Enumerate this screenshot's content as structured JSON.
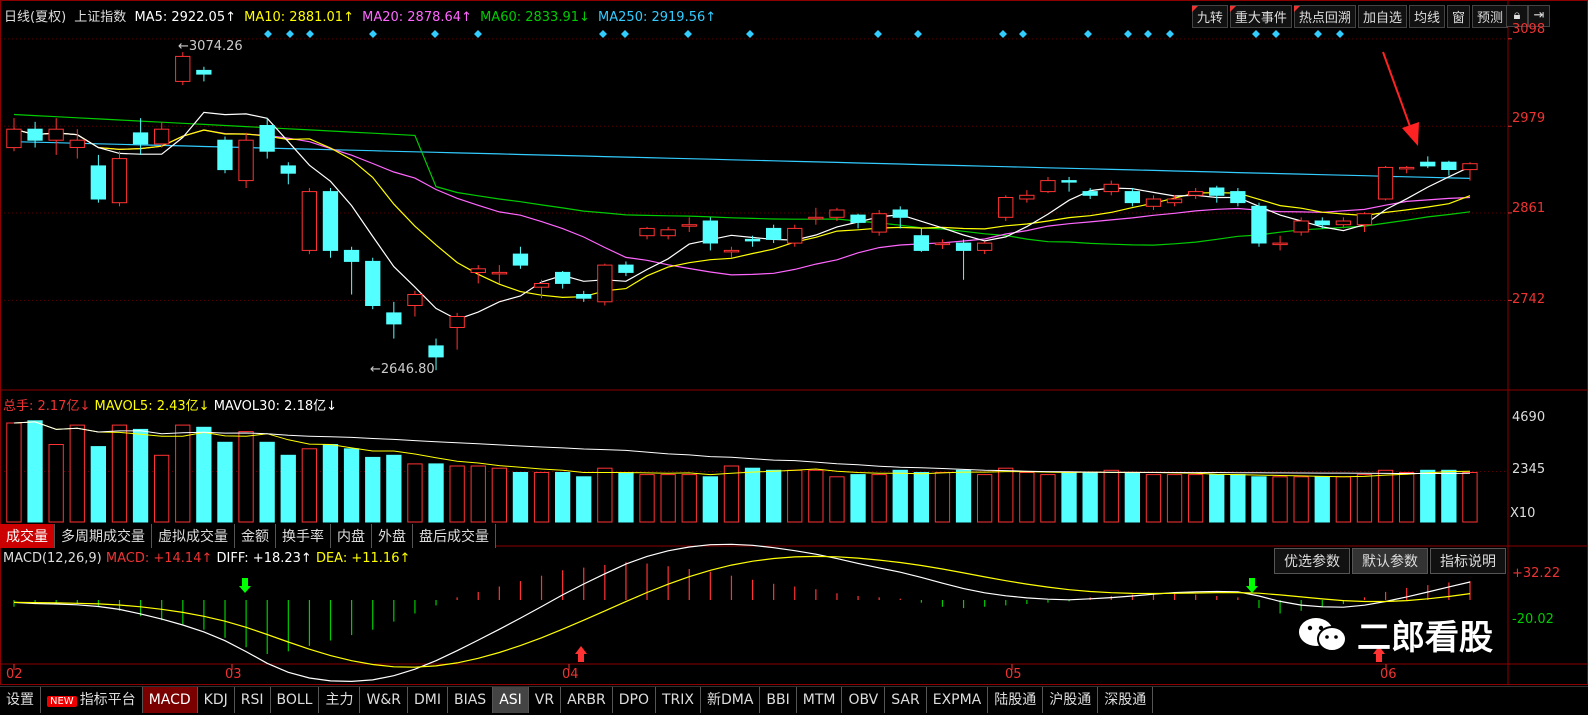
{
  "header": {
    "period": "日线(夏权)",
    "index_name": "上证指数",
    "ma5": "MA5: 2922.05↑",
    "ma10": "MA10: 2881.01↑",
    "ma20": "MA20: 2878.64↑",
    "ma60": "MA60: 2833.91↓",
    "ma250": "MA250: 2919.56↑"
  },
  "toolbar": [
    "九转",
    "重大事件",
    "热点回溯",
    "加自选",
    "均线",
    "窗",
    "预测"
  ],
  "toolbar_icons": [
    "lock-icon",
    "exit-icon"
  ],
  "price_axis": [
    "3098",
    "2979",
    "2861",
    "2742"
  ],
  "price_annotations": {
    "high": "3074.26",
    "low": "2646.80"
  },
  "volume_header": {
    "total": "总手: 2.17亿↓",
    "mavol5": "MAVOL5: 2.43亿↓",
    "mavol30": "MAVOL30: 2.18亿↓"
  },
  "volume_axis": [
    "4690",
    "2345",
    "X10"
  ],
  "volume_tabs": [
    "成交量",
    "多周期成交量",
    "虚拟成交量",
    "金额",
    "换手率",
    "内盘",
    "外盘",
    "盘后成交量"
  ],
  "macd_header": {
    "name": "MACD(12,26,9)",
    "macd": "MACD: +14.14↑",
    "diff": "DIFF: +18.23↑",
    "dea": "DEA: +11.16↑"
  },
  "macd_buttons": [
    "优选参数",
    "默认参数",
    "指标说明"
  ],
  "macd_axis": [
    "+32.22",
    "-20.02"
  ],
  "date_axis": [
    "02",
    "03",
    "04",
    "05",
    "06"
  ],
  "bottom_bar": [
    "设置",
    "指标平台",
    "MACD",
    "KDJ",
    "RSI",
    "BOLL",
    "主力",
    "W&R",
    "DMI",
    "BIAS",
    "ASI",
    "VR",
    "ARBR",
    "DPO",
    "TRIX",
    "新DMA",
    "BBI",
    "MTM",
    "OBV",
    "SAR",
    "EXPMA",
    "陆股通",
    "沪股通",
    "深股通"
  ],
  "new_badge": "NEW",
  "watermark": "二郎看股",
  "colors": {
    "up": "#ff3333",
    "down": "#54ffff",
    "ma5": "#ffffff",
    "ma10": "#ffff00",
    "ma20": "#ff66ff",
    "ma60": "#00cc00",
    "ma250": "#33ccff",
    "grid": "#8b0000"
  },
  "chart_data": {
    "type": "candlestick",
    "ylim": [
      2620,
      3110
    ],
    "candles": [
      [
        2950,
        2975,
        2945,
        2990,
        "u"
      ],
      [
        2975,
        2960,
        2950,
        2985,
        "d"
      ],
      [
        2960,
        2975,
        2940,
        2990,
        "u"
      ],
      [
        2950,
        2960,
        2935,
        2975,
        "u"
      ],
      [
        2925,
        2880,
        2875,
        2940,
        "d"
      ],
      [
        2875,
        2935,
        2870,
        2945,
        "u"
      ],
      [
        2970,
        2955,
        2940,
        2990,
        "d"
      ],
      [
        2955,
        2975,
        2950,
        2985,
        "u"
      ],
      [
        3040,
        3074,
        3035,
        3080,
        "u"
      ],
      [
        3055,
        3050,
        3040,
        3060,
        "d"
      ],
      [
        2960,
        2920,
        2915,
        2965,
        "d"
      ],
      [
        2905,
        2960,
        2895,
        2970,
        "u"
      ],
      [
        2980,
        2945,
        2935,
        2990,
        "d"
      ],
      [
        2925,
        2915,
        2900,
        2930,
        "d"
      ],
      [
        2810,
        2890,
        2805,
        2895,
        "u"
      ],
      [
        2890,
        2810,
        2800,
        2895,
        "d"
      ],
      [
        2810,
        2795,
        2750,
        2815,
        "d"
      ],
      [
        2795,
        2735,
        2730,
        2800,
        "d"
      ],
      [
        2725,
        2710,
        2690,
        2740,
        "d"
      ],
      [
        2735,
        2750,
        2720,
        2755,
        "u"
      ],
      [
        2680,
        2665,
        2647,
        2690,
        "d"
      ],
      [
        2705,
        2720,
        2675,
        2725,
        "u"
      ],
      [
        2780,
        2785,
        2765,
        2790,
        "u"
      ],
      [
        2780,
        2780,
        2765,
        2790,
        "u"
      ],
      [
        2805,
        2790,
        2785,
        2815,
        "d"
      ],
      [
        2765,
        2760,
        2745,
        2770,
        "u"
      ],
      [
        2780,
        2765,
        2758,
        2782,
        "d"
      ],
      [
        2750,
        2745,
        2740,
        2755,
        "d"
      ],
      [
        2740,
        2790,
        2735,
        2792,
        "u"
      ],
      [
        2790,
        2780,
        2775,
        2795,
        "d"
      ],
      [
        2830,
        2840,
        2825,
        2842,
        "u"
      ],
      [
        2830,
        2838,
        2825,
        2842,
        "u"
      ],
      [
        2843,
        2845,
        2835,
        2855,
        "u"
      ],
      [
        2850,
        2820,
        2810,
        2855,
        "d"
      ],
      [
        2810,
        2810,
        2800,
        2815,
        "u"
      ],
      [
        2825,
        2825,
        2815,
        2830,
        "d"
      ],
      [
        2840,
        2825,
        2820,
        2845,
        "d"
      ],
      [
        2820,
        2840,
        2815,
        2845,
        "u"
      ],
      [
        2853,
        2855,
        2845,
        2868,
        "u"
      ],
      [
        2855,
        2865,
        2850,
        2868,
        "u"
      ],
      [
        2848,
        2858,
        2840,
        2860,
        "d"
      ],
      [
        2835,
        2860,
        2830,
        2865,
        "u"
      ],
      [
        2865,
        2855,
        2840,
        2870,
        "d"
      ],
      [
        2830,
        2810,
        2808,
        2840,
        "d"
      ],
      [
        2820,
        2820,
        2812,
        2825,
        "u"
      ],
      [
        2820,
        2810,
        2770,
        2825,
        "d"
      ],
      [
        2810,
        2820,
        2805,
        2822,
        "u"
      ],
      [
        2855,
        2882,
        2850,
        2885,
        "u"
      ],
      [
        2885,
        2880,
        2875,
        2892,
        "u"
      ],
      [
        2890,
        2905,
        2888,
        2910,
        "u"
      ],
      [
        2905,
        2905,
        2890,
        2910,
        "d"
      ],
      [
        2890,
        2885,
        2880,
        2895,
        "d"
      ],
      [
        2890,
        2900,
        2885,
        2905,
        "u"
      ],
      [
        2890,
        2875,
        2870,
        2895,
        "d"
      ],
      [
        2870,
        2880,
        2865,
        2885,
        "u"
      ],
      [
        2875,
        2880,
        2870,
        2885,
        "u"
      ],
      [
        2885,
        2890,
        2880,
        2895,
        "u"
      ],
      [
        2895,
        2885,
        2875,
        2898,
        "d"
      ],
      [
        2890,
        2875,
        2870,
        2895,
        "d"
      ],
      [
        2870,
        2820,
        2815,
        2875,
        "d"
      ],
      [
        2820,
        2820,
        2810,
        2830,
        "u"
      ],
      [
        2835,
        2850,
        2830,
        2855,
        "u"
      ],
      [
        2850,
        2845,
        2840,
        2855,
        "d"
      ],
      [
        2845,
        2850,
        2840,
        2855,
        "u"
      ],
      [
        2845,
        2860,
        2835,
        2862,
        "u"
      ],
      [
        2880,
        2923,
        2878,
        2925,
        "u"
      ],
      [
        2923,
        2923,
        2915,
        2925,
        "u"
      ],
      [
        2930,
        2925,
        2922,
        2938,
        "d"
      ],
      [
        2930,
        2920,
        2912,
        2932,
        "d"
      ],
      [
        2920,
        2928,
        2905,
        2930,
        "u"
      ]
    ],
    "volume": [
      4600,
      4700,
      3600,
      4500,
      3500,
      4500,
      4300,
      3100,
      4500,
      4400,
      3700,
      4200,
      3700,
      3100,
      3400,
      3600,
      3400,
      3000,
      3100,
      2700,
      2700,
      2600,
      2600,
      2500,
      2300,
      2300,
      2300,
      2100,
      2500,
      2300,
      2200,
      2200,
      2200,
      2100,
      2600,
      2500,
      2400,
      2400,
      2400,
      2100,
      2200,
      2200,
      2400,
      2300,
      2300,
      2400,
      2200,
      2500,
      2300,
      2200,
      2300,
      2300,
      2400,
      2300,
      2200,
      2200,
      2200,
      2200,
      2200,
      2100,
      2100,
      2100,
      2100,
      2100,
      2200,
      2400,
      2300,
      2400,
      2400,
      2300
    ],
    "macd_hist": [
      -5,
      -3,
      -2,
      -3,
      -5,
      -8,
      -12,
      -15,
      -18,
      -22,
      -28,
      -35,
      -40,
      -38,
      -34,
      -30,
      -26,
      -22,
      -16,
      -10,
      -4,
      2,
      6,
      10,
      14,
      18,
      22,
      24,
      26,
      28,
      27,
      25,
      23,
      21,
      18,
      15,
      12,
      10,
      8,
      5,
      3,
      2,
      1,
      -2,
      -5,
      -6,
      -5,
      -4,
      -3,
      -2,
      -1,
      2,
      3,
      4,
      5,
      5,
      4,
      3,
      2,
      -6,
      -10,
      -8,
      -5,
      -3,
      2,
      6,
      9,
      11,
      13,
      14
    ]
  }
}
